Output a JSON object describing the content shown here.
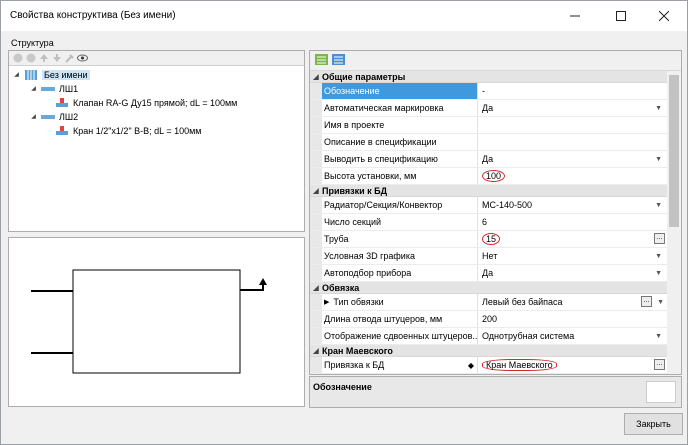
{
  "window": {
    "title": "Свойства конструктива (Без имени)"
  },
  "structure_label": "Структура",
  "tree": {
    "root": "Без имени",
    "branch1": "ЛШ1",
    "item1": "Клапан RA-G Ду15 прямой; dL = 100мм",
    "branch2": "ЛШ2",
    "item2": "Кран 1/2\"x1/2\" В-В; dL = 100мм"
  },
  "groups": {
    "general": "Общие параметры",
    "db": "Привязки к БД",
    "binding": "Обвязка",
    "maevsky": "Кран Маевского"
  },
  "props": {
    "designation": {
      "name": "Обозначение",
      "value": "-"
    },
    "auto_mark": {
      "name": "Автоматическая маркировка",
      "value": "Да"
    },
    "project_name": {
      "name": "Имя в проекте",
      "value": ""
    },
    "spec_desc": {
      "name": "Описание в спецификации",
      "value": ""
    },
    "show_spec": {
      "name": "Выводить в спецификацию",
      "value": "Да"
    },
    "height": {
      "name": "Высота установки, мм",
      "value": "100"
    },
    "radiator": {
      "name": "Радиатор/Секция/Конвектор",
      "value": "МС-140-500"
    },
    "sections": {
      "name": "Число секций",
      "value": "6"
    },
    "pipe": {
      "name": "Труба",
      "value": "15"
    },
    "graphics3d": {
      "name": "Условная 3D графика",
      "value": "Нет"
    },
    "autoselect": {
      "name": "Автоподбор прибора",
      "value": "Да"
    },
    "binding_type": {
      "name": "Тип обвязки",
      "value": "Левый без байпаса"
    },
    "branch_len": {
      "name": "Длина отвода штуцеров, мм",
      "value": "200"
    },
    "double_display": {
      "name": "Отображение сдвоенных штуцеров...",
      "value": "Однотрубная система"
    },
    "db_link": {
      "name": "Привязка к БД",
      "value": "Кран Маевского"
    }
  },
  "description": {
    "title": "Обозначение"
  },
  "buttons": {
    "close": "Закрыть"
  },
  "colors": {
    "selection": "#3f99dc",
    "highlight": "#d32a2a"
  }
}
